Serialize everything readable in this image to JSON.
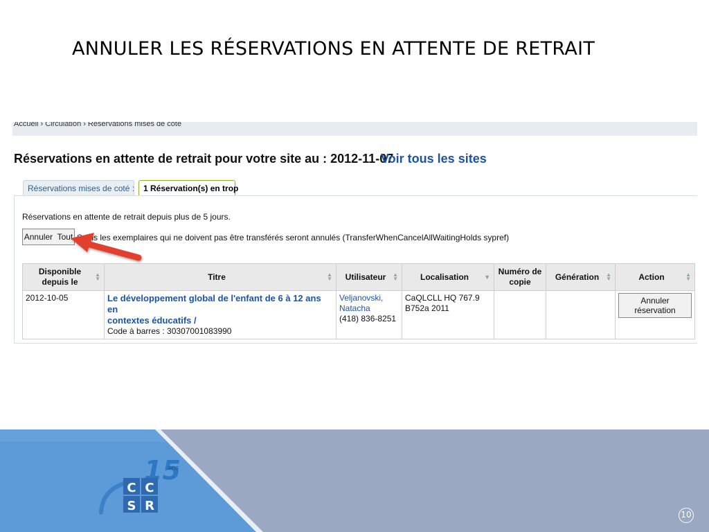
{
  "slide": {
    "title": "ANNULER LES RÉSERVATIONS EN ATTENTE DE RETRAIT",
    "page_number": "10"
  },
  "breadcrumb": "Accueil › Circulation › Réservations mises de coté",
  "heading": "Réservations en attente de retrait pour votre site au : 2012-11-07",
  "voir_tous": "Voir tous les sites",
  "tabs": [
    {
      "label": "Réservations mises de coté :",
      "active": false
    },
    {
      "label": "1 Réservation(s) en trop",
      "active": true
    }
  ],
  "info_text": "Réservations en attente de retrait depuis plus de 5 jours.",
  "cancel_all_label": "Annuler  Tout",
  "cancel_note": "Seuls les exemplaires qui ne doivent pas être transférés seront annulés (TransferWhenCancelAllWaitingHolds sypref)",
  "table": {
    "headers": {
      "available_line1": "Disponible",
      "available_line2": "depuis le",
      "title": "Titre",
      "user": "Utilisateur",
      "location": "Localisation",
      "copy_line1": "Numéro de",
      "copy_line2": "copie",
      "generation": "Génération",
      "action": "Action"
    },
    "row": {
      "date": "2012-10-05",
      "title_line1": "Le développement global de l'enfant de 6 à 12 ans en",
      "title_line2": "contextes éducatifs /",
      "barcode": "Code à barres : 30307001083990",
      "user_line1": "Veljanovski,",
      "user_line2": "Natacha",
      "phone": "(418) 836-8251",
      "location_line1": "CaQLCLL HQ 767.9",
      "location_line2": "B752a 2011",
      "copy_number": "",
      "generation": "",
      "action_label": "Annuler réservation"
    }
  },
  "colors": {
    "link_blue": "#1c53a8",
    "footer_blue": "#5c9bd8",
    "footer_gray": "#9aa8c2",
    "arrow_red": "#e2402d"
  }
}
